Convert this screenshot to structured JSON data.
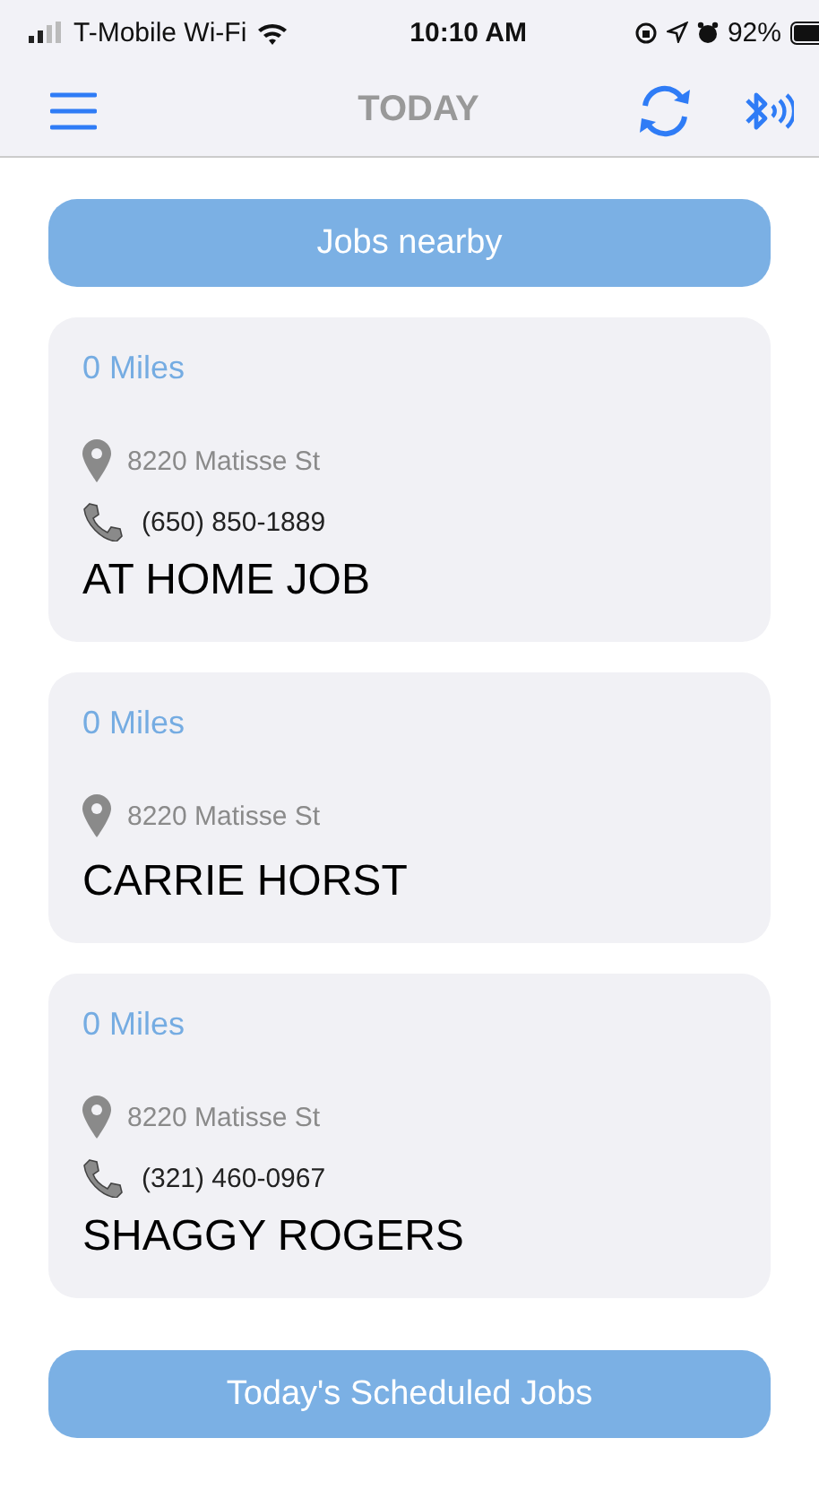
{
  "status_bar": {
    "carrier": "T-Mobile Wi-Fi",
    "time": "10:10 AM",
    "battery": "92%"
  },
  "nav": {
    "title": "TODAY"
  },
  "top_button": "Jobs nearby",
  "jobs": [
    {
      "distance": "0 Miles",
      "address": "8220 Matisse St",
      "phone": "(650) 850-1889",
      "name": "AT HOME JOB"
    },
    {
      "distance": "0 Miles",
      "address": "8220 Matisse St",
      "name": "CARRIE HORST"
    },
    {
      "distance": "0 Miles",
      "address": "8220 Matisse St",
      "phone": "(321) 460-0967",
      "name": "SHAGGY ROGERS"
    }
  ],
  "bottom_button": "Today's Scheduled Jobs"
}
